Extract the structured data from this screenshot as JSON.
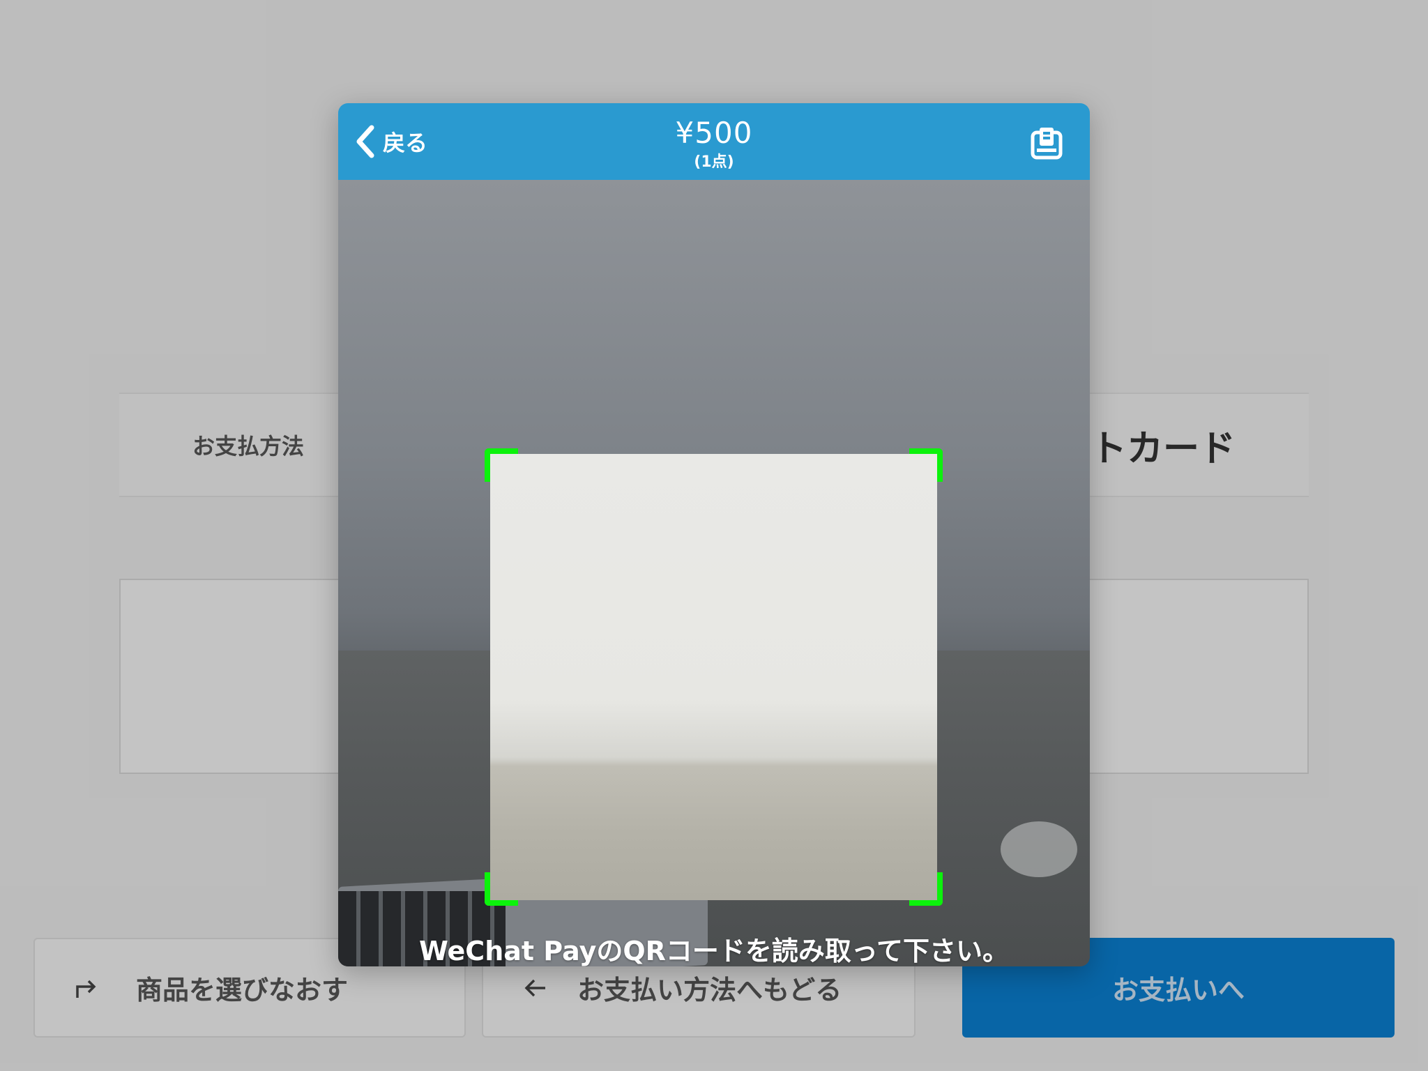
{
  "background": {
    "payment_method_label": "お支払方法",
    "payment_method_value": "ットカード",
    "buttons": {
      "reselect": "商品を選びなおす",
      "back_to_method": "お支払い方法へもどる",
      "to_payment": "お支払いへ"
    }
  },
  "modal": {
    "back_label": "戻る",
    "amount": "¥500",
    "item_count": "(1点)",
    "instruction": "WeChat PayのQRコードを読み取って下さい。",
    "icons": {
      "back": "chevron-left-icon",
      "receipt": "receipt-icon",
      "camera_switch": "camera-switch-icon"
    }
  },
  "colors": {
    "header": "#2a9ad0",
    "scan_corners": "#0cf20c",
    "primary_button": "#0a7fd0"
  }
}
